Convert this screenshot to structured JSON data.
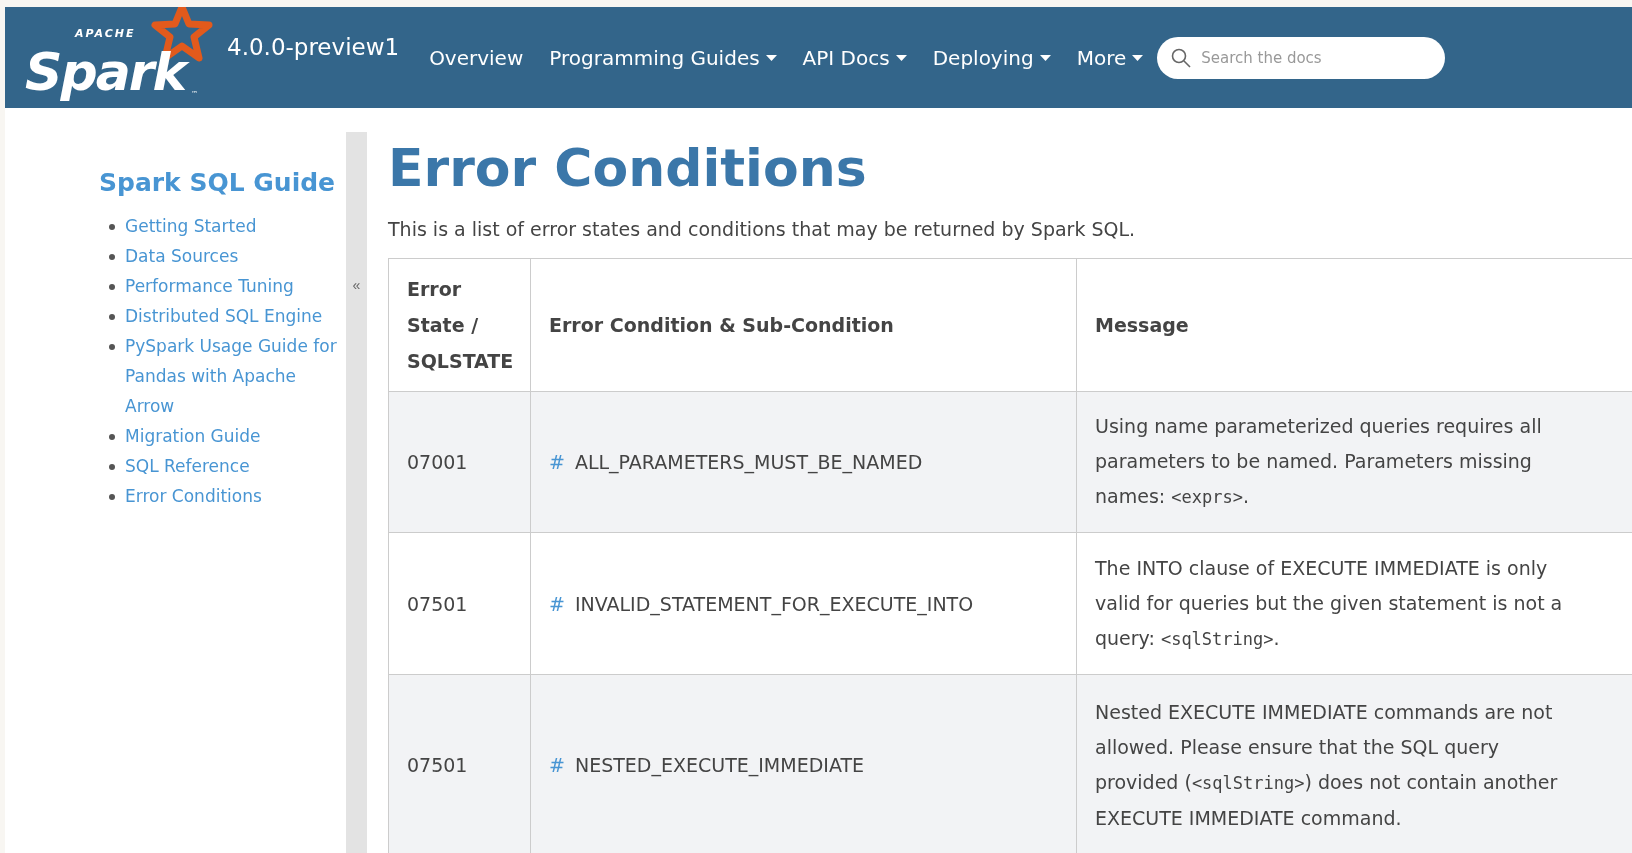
{
  "logo": {
    "small": "APACHE",
    "name": "Spark",
    "tm": "™"
  },
  "version": "4.0.0-preview1",
  "nav": [
    {
      "label": "Overview",
      "dropdown": false
    },
    {
      "label": "Programming Guides",
      "dropdown": true
    },
    {
      "label": "API Docs",
      "dropdown": true
    },
    {
      "label": "Deploying",
      "dropdown": true
    },
    {
      "label": "More",
      "dropdown": true
    }
  ],
  "search": {
    "placeholder": "Search the docs"
  },
  "sidebar": {
    "title": "Spark SQL Guide",
    "items": [
      "Getting Started",
      "Data Sources",
      "Performance Tuning",
      "Distributed SQL Engine",
      "PySpark Usage Guide for Pandas with Apache Arrow",
      "Migration Guide",
      "SQL Reference",
      "Error Conditions"
    ],
    "collapse": "«"
  },
  "page": {
    "title": "Error Conditions",
    "intro": "This is a list of error states and conditions that may be returned by Spark SQL."
  },
  "table": {
    "columns": [
      "Error State / SQLSTATE",
      "Error Condition & Sub-Condition",
      "Message"
    ],
    "rows": [
      {
        "state": "07001",
        "anchor": "#",
        "condition": "ALL_PARAMETERS_MUST_BE_NAMED",
        "message": [
          {
            "kind": "text",
            "text": "Using name parameterized queries requires all parameters to be named. Parameters missing names: "
          },
          {
            "kind": "code",
            "text": "<exprs>"
          },
          {
            "kind": "text",
            "text": "."
          }
        ]
      },
      {
        "state": "07501",
        "anchor": "#",
        "condition": "INVALID_STATEMENT_FOR_EXECUTE_INTO",
        "message": [
          {
            "kind": "text",
            "text": "The INTO clause of EXECUTE IMMEDIATE is only valid for queries but the given statement is not a query: "
          },
          {
            "kind": "code",
            "text": "<sqlString>"
          },
          {
            "kind": "text",
            "text": "."
          }
        ]
      },
      {
        "state": "07501",
        "anchor": "#",
        "condition": "NESTED_EXECUTE_IMMEDIATE",
        "message": [
          {
            "kind": "text",
            "text": "Nested EXECUTE IMMEDIATE commands are not allowed. Please ensure that the SQL query provided ("
          },
          {
            "kind": "code",
            "text": "<sqlString>"
          },
          {
            "kind": "text",
            "text": ") does not contain another EXECUTE IMMEDIATE command."
          }
        ]
      }
    ]
  }
}
